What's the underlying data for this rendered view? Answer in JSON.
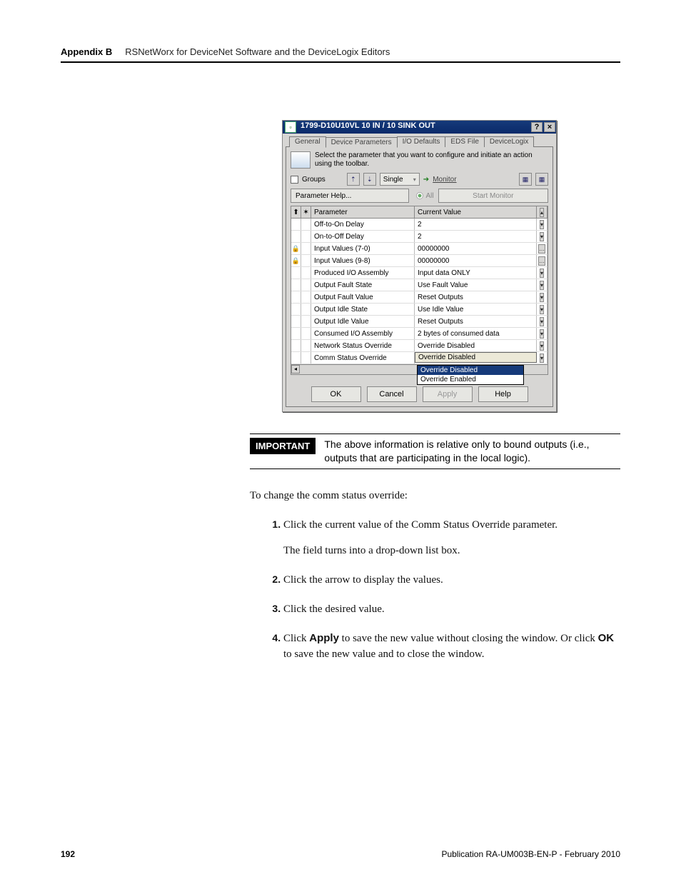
{
  "header": {
    "appendix": "Appendix B",
    "chapter": "RSNetWorx for DeviceNet Software and the DeviceLogix Editors"
  },
  "dialog": {
    "title": "1799-D10U10VL 10 IN / 10 SINK OUT",
    "tabs": [
      "General",
      "Device Parameters",
      "I/O Defaults",
      "EDS File",
      "DeviceLogix"
    ],
    "active_tab": 1,
    "help_text": "Select the parameter that you want to configure and initiate an action using the toolbar.",
    "groups_label": "Groups",
    "single_label": "Single",
    "monitor_label": "Monitor",
    "all_label": "All",
    "param_help_label": "Parameter Help...",
    "start_monitor_label": "Start Monitor",
    "grid_head": {
      "param": "Parameter",
      "value": "Current Value"
    },
    "rows": [
      {
        "locked": false,
        "param": "Off-to-On Delay",
        "value": "2",
        "ctl": "dd"
      },
      {
        "locked": false,
        "param": "On-to-Off Delay",
        "value": "2",
        "ctl": "dd"
      },
      {
        "locked": true,
        "param": "Input Values (7-0)",
        "value": "00000000",
        "ctl": "dots"
      },
      {
        "locked": true,
        "param": "Input Values (9-8)",
        "value": "00000000",
        "ctl": "dots"
      },
      {
        "locked": false,
        "param": "Produced I/O Assembly",
        "value": "Input data ONLY",
        "ctl": "dd"
      },
      {
        "locked": false,
        "param": "Output Fault State",
        "value": "Use Fault Value",
        "ctl": "dd"
      },
      {
        "locked": false,
        "param": "Output Fault Value",
        "value": "Reset Outputs",
        "ctl": "dd"
      },
      {
        "locked": false,
        "param": "Output Idle State",
        "value": "Use Idle Value",
        "ctl": "dd"
      },
      {
        "locked": false,
        "param": "Output Idle Value",
        "value": "Reset Outputs",
        "ctl": "dd"
      },
      {
        "locked": false,
        "param": "Consumed I/O Assembly",
        "value": "2 bytes of consumed data",
        "ctl": "dd"
      },
      {
        "locked": false,
        "param": "Network Status Override",
        "value": "Override Disabled",
        "ctl": "dd"
      },
      {
        "locked": false,
        "param": "Comm Status Override",
        "value": "Override Disabled",
        "ctl": "dd",
        "active": true
      }
    ],
    "dropdown_options": [
      "Override Disabled",
      "Override Enabled"
    ],
    "buttons": {
      "ok": "OK",
      "cancel": "Cancel",
      "apply": "Apply",
      "help": "Help"
    }
  },
  "note": {
    "tag": "IMPORTANT",
    "text": "The above information is relative only to bound outputs (i.e., outputs that are participating in the local logic)."
  },
  "intro": "To change the comm status override:",
  "steps": [
    {
      "n": "1.",
      "t": "Click the current value of the Comm Status Override parameter.",
      "sub": "The field turns into a drop-down list box."
    },
    {
      "n": "2.",
      "t": "Click the arrow to display the values."
    },
    {
      "n": "3.",
      "t": "Click the desired value."
    },
    {
      "n": "4.",
      "t": "Click <b>Apply</b> to save the new value without closing the window. Or click <b>OK</b> to save the new value and to close the window."
    }
  ],
  "footer": {
    "page": "192",
    "pub": "Publication RA-UM003B-EN-P - February 2010"
  }
}
